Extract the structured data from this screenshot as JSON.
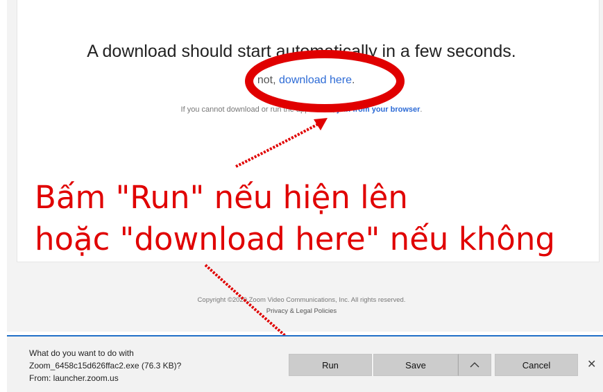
{
  "main": {
    "headline": "A download should start automatically in a few seconds.",
    "sub_prefix": "If not, ",
    "sub_link": "download here",
    "sub_suffix": ".",
    "small_prefix": "If you cannot download or run the application, ",
    "small_link": "join from your browser",
    "small_suffix": "."
  },
  "footer": {
    "copyright": "Copyright ©2020 Zoom Video Communications, Inc. All rights reserved.",
    "policies": "Privacy & Legal Policies"
  },
  "annotation": {
    "line1": "Bấm \"Run\" nếu hiện lên",
    "line2": "hoặc \"download here\" nếu không",
    "color": "#e00000"
  },
  "download_bar": {
    "question": "What do you want to do with",
    "file": "Zoom_6458c15d626ffac2.exe (76.3 KB)?",
    "from": "From: launcher.zoom.us",
    "run_label": "Run",
    "save_label": "Save",
    "chevron_icon": "chevron-up-icon",
    "cancel_label": "Cancel",
    "close_icon": "close-icon",
    "accent_color": "#1f6fc8"
  }
}
